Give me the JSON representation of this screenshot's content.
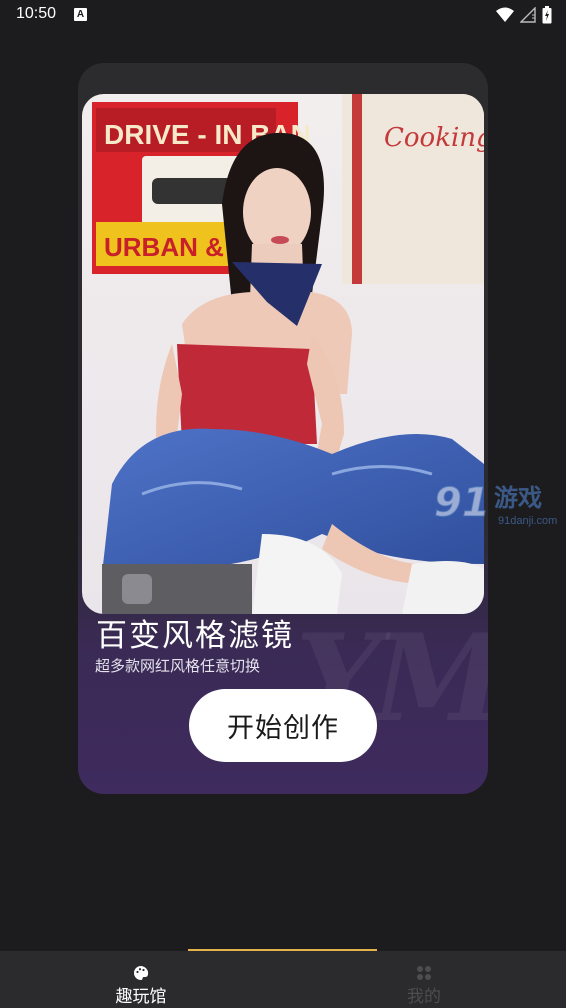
{
  "status_bar": {
    "time": "10:50",
    "badge": "A"
  },
  "card": {
    "title": "百变风格滤镜",
    "subtitle": "超多款网红风格任意切换",
    "start_button": "开始创作",
    "bg_text": "YM"
  },
  "photo": {
    "poster_left_lines": [
      "DRIVE - IN BAN",
      "URBAN & SU"
    ],
    "poster_right": "Cooking"
  },
  "watermark": {
    "number": "91",
    "cn": "游戏",
    "site": "91danji.com"
  },
  "bottom_nav": {
    "items": [
      {
        "label": "趣玩馆",
        "icon": "palette-icon",
        "active": true
      },
      {
        "label": "我的",
        "icon": "grid-icon",
        "active": false
      }
    ],
    "accent": "#e3b24a"
  }
}
